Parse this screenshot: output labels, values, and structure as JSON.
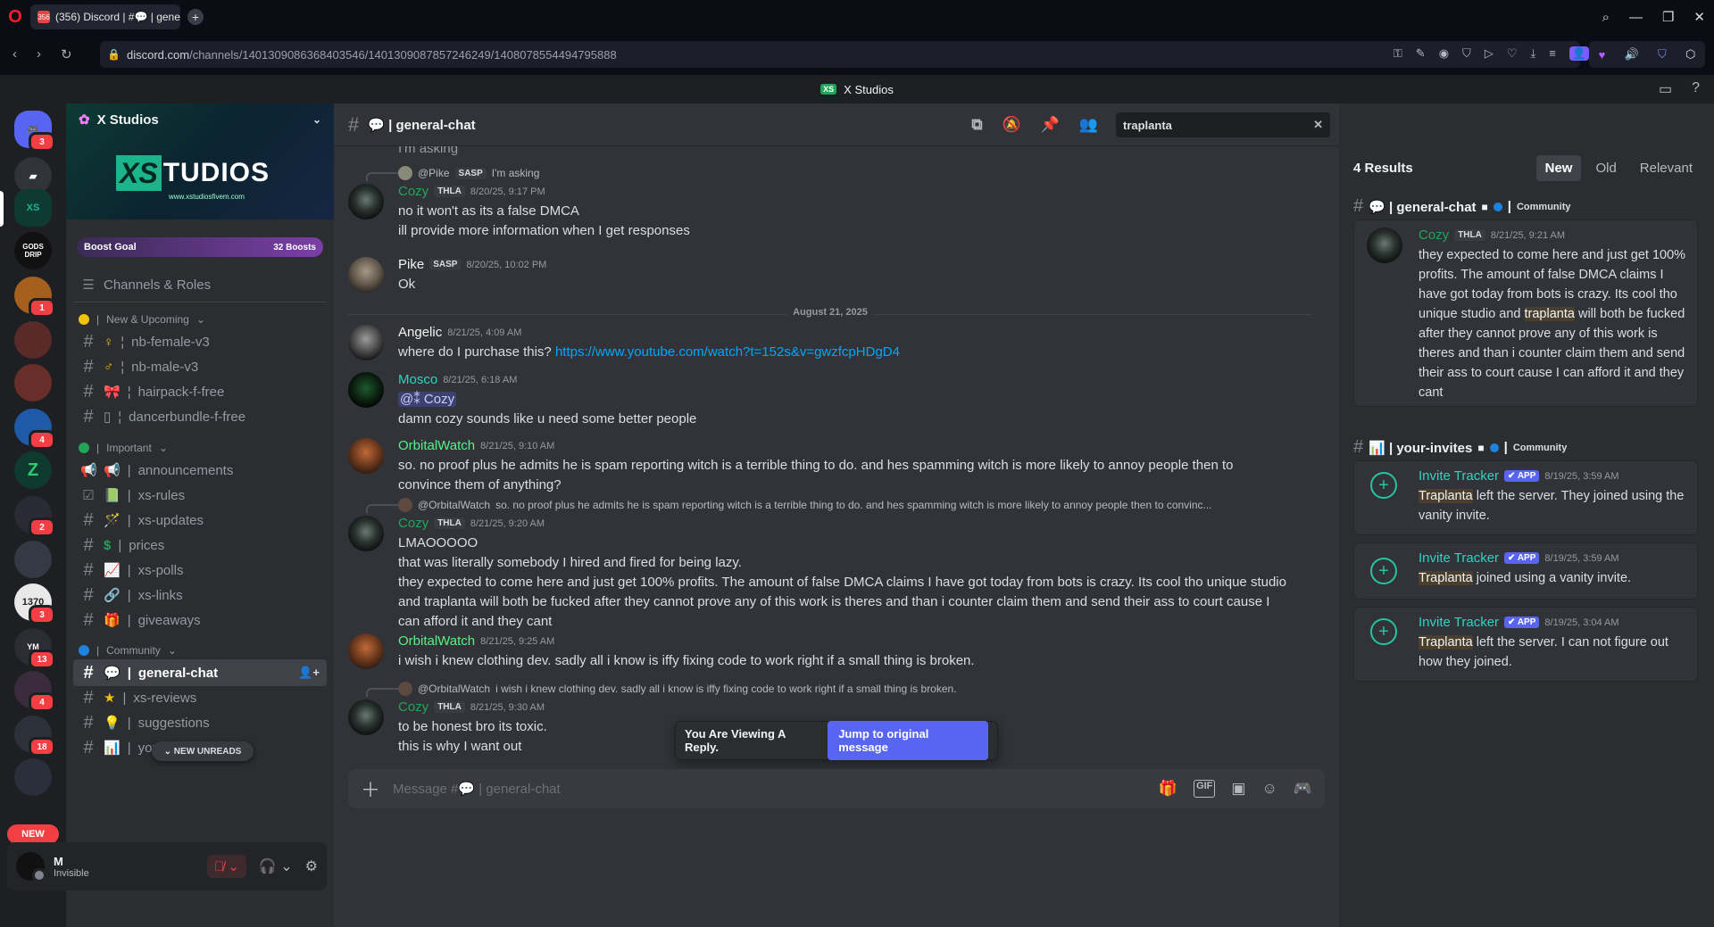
{
  "browser": {
    "tab_title": "(356) Discord | #💬 | gene",
    "tab_badge": "356",
    "new_tab": "+",
    "url_host": "discord.com",
    "url_path": "/channels/1401309086368403546/1401309087857246249/1408078554494795888"
  },
  "app": {
    "window_title": "X Studios",
    "window_logo": "XS"
  },
  "rail": {
    "home_badge": "3",
    "servers": [
      {
        "label": "XS",
        "badge": ""
      },
      {
        "label": "GODS DRIP",
        "badge": ""
      },
      {
        "label": "",
        "badge": "1"
      },
      {
        "label": "",
        "badge": ""
      },
      {
        "label": "",
        "badge": ""
      },
      {
        "label": "",
        "badge": "4"
      },
      {
        "label": "Z",
        "badge": ""
      },
      {
        "label": "",
        "badge": "2"
      },
      {
        "label": "",
        "badge": ""
      },
      {
        "label": "1370",
        "badge": "3"
      },
      {
        "label": "YM",
        "badge": "13"
      },
      {
        "label": "",
        "badge": "4"
      },
      {
        "label": "",
        "badge": "18"
      },
      {
        "label": "",
        "badge": ""
      }
    ],
    "new_label": "NEW"
  },
  "sidebar": {
    "server_name": "X Studios",
    "banner_logo_xs": "XS",
    "banner_logo_text": "TUDIOS",
    "banner_sub": "www.xstudiosfivem.com",
    "boost_label": "Boost Goal",
    "boost_count": "32 Boosts",
    "channels_roles": "Channels & Roles",
    "categories": [
      {
        "label": "New & Upcoming",
        "color": "#f0c20e"
      },
      {
        "label": "Important",
        "color": "#23a559"
      },
      {
        "label": "Community",
        "color": "#1e82e0"
      }
    ],
    "channels": [
      {
        "emoji": "♀",
        "name": "nb-female-v3"
      },
      {
        "emoji": "♂",
        "name": "nb-male-v3"
      },
      {
        "emoji": "🎀",
        "name": "hairpack-f-free"
      },
      {
        "emoji": "▯",
        "name": "dancerbundle-f-free"
      },
      {
        "emoji": "📢",
        "name": "announcements"
      },
      {
        "emoji": "📗",
        "name": "xs-rules"
      },
      {
        "emoji": "🪄",
        "name": "xs-updates"
      },
      {
        "emoji": "$",
        "name": "prices"
      },
      {
        "emoji": "📈",
        "name": "xs-polls"
      },
      {
        "emoji": "🔗",
        "name": "xs-links"
      },
      {
        "emoji": "🎁",
        "name": "giveaways"
      },
      {
        "emoji": "💬",
        "name": "general-chat"
      },
      {
        "emoji": "★",
        "name": "xs-reviews"
      },
      {
        "emoji": "💡",
        "name": "suggestions"
      },
      {
        "emoji": "📊",
        "name": "your-invites"
      }
    ],
    "new_unreads": "NEW UNREADS"
  },
  "user": {
    "name": "M",
    "status": "Invisible"
  },
  "chat": {
    "channel_name": "💬 | general-chat",
    "search_value": "traplanta",
    "top_snippet": "I'm asking",
    "date_divider": "August 21, 2025",
    "messages": [
      {
        "reply_name": "@Pike",
        "reply_tag": "SASP",
        "reply_text": "I'm asking",
        "author": "Cozy",
        "tag": "THLA",
        "time": "8/20/25, 9:17 PM",
        "lines": [
          "no it won't as its a false DMCA",
          "ill provide more information when I get responses"
        ]
      },
      {
        "author": "Pike",
        "tag": "SASP",
        "time": "8/20/25, 10:02 PM",
        "lines": [
          "Ok"
        ]
      },
      {
        "author": "Angelic",
        "time": "8/21/25, 4:09 AM",
        "text": "where do I purchase this? ",
        "link": "https://www.youtube.com/watch?t=152s&v=gwzfcpHDgD4"
      },
      {
        "author": "Mosco",
        "time": "8/21/25, 6:18 AM",
        "mention": "@⁑ Cozy",
        "lines": [
          "damn cozy sounds like u need some better people"
        ]
      },
      {
        "author": "OrbitalWatch",
        "time": "8/21/25, 9:10 AM",
        "lines": [
          "so. no proof plus he admits he is spam reporting witch is a terrible thing to do. and hes spamming witch is more likely to annoy people then to convince them of anything?"
        ]
      },
      {
        "reply_name": "@OrbitalWatch",
        "reply_text": "so. no proof plus he admits he is spam reporting witch is a terrible thing to do. and hes spamming witch is more likely to annoy people then to convinc...",
        "author": "Cozy",
        "tag": "THLA",
        "time": "8/21/25, 9:20 AM",
        "lines": [
          "LMAOOOOO",
          "that was literally somebody I hired and fired for being lazy.",
          "they expected to come here and just get 100% profits. The amount of false DMCA claims I have got today from bots is crazy. Its cool tho unique studio and traplanta will both be fucked after they cannot prove any of this work is theres and than i counter claim them and send their ass to court cause I can afford it and they cant"
        ]
      },
      {
        "author": "OrbitalWatch",
        "time": "8/21/25, 9:25 AM",
        "lines": [
          "i wish i knew clothing dev. sadly all i know is iffy fixing code to work right if a small thing is broken."
        ]
      },
      {
        "reply_name": "@OrbitalWatch",
        "reply_text": "i wish i knew clothing dev. sadly all i know is iffy fixing code to work right if a small thing is broken.",
        "author": "Cozy",
        "tag": "THLA",
        "time": "8/21/25, 9:30 AM",
        "lines": [
          "to be honest bro its toxic.",
          "this is why I want out"
        ]
      }
    ],
    "viewing_reply": "You Are Viewing A Reply.",
    "jump_button": "Jump to original message",
    "composer_placeholder": "Message #💬 | general-chat"
  },
  "results": {
    "count": "4 Results",
    "tabs": [
      "New",
      "Old",
      "Relevant"
    ],
    "groups": [
      {
        "name": "💬 | general-chat",
        "community": "Community"
      },
      {
        "name": "📊 | your-invites",
        "community": "Community"
      }
    ],
    "cozy_result": {
      "author": "Cozy",
      "tag": "THLA",
      "time": "8/21/25, 9:21 AM",
      "text_before": "they expected to come here and just get 100% profits. The amount of false DMCA claims I have got today from bots is crazy. Its cool tho unique studio and ",
      "highlight": "traplanta",
      "text_after": " will both be fucked after they cannot prove any of this work is theres and than i counter claim them and send their ass to court cause I can afford it and they cant"
    },
    "invite_results": [
      {
        "author": "Invite Tracker",
        "app": "APP",
        "time": "8/19/25, 3:59 AM",
        "highlight": "Traplanta",
        "text": " left the server. They joined using the vanity invite."
      },
      {
        "author": "Invite Tracker",
        "app": "APP",
        "time": "8/19/25, 3:59 AM",
        "highlight": "Traplanta",
        "text": " joined using a vanity invite."
      },
      {
        "author": "Invite Tracker",
        "app": "APP",
        "time": "8/19/25, 3:04 AM",
        "highlight": "Traplanta",
        "text": " left the server. I can not figure out how they joined."
      }
    ]
  }
}
